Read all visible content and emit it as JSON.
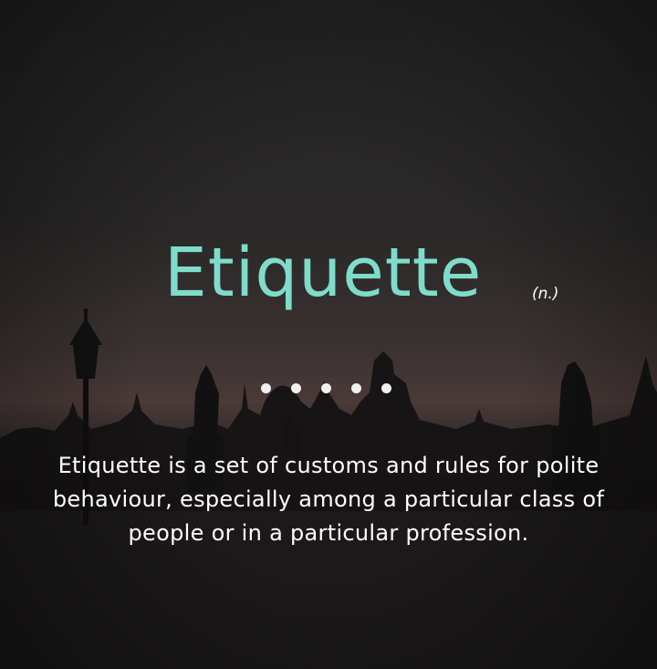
{
  "word": "Etiquette",
  "part_of_speech": "(n.)",
  "separator_dots": 5,
  "definition": {
    "line1": "Etiquette is a set of customs and rules for polite",
    "line2": "behaviour, especially among a particular class of",
    "line3": "people or in a particular profession."
  },
  "colors": {
    "word": "#7fdccb",
    "text": "#ffffff"
  }
}
